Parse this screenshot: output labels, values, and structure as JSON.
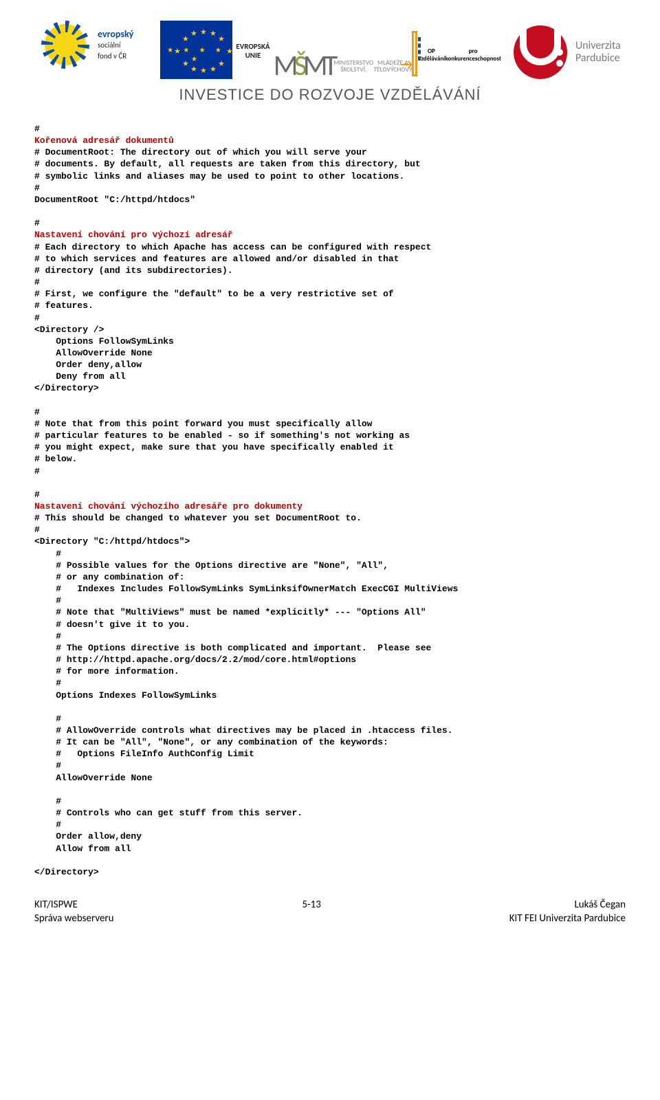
{
  "logos": {
    "esf": {
      "title": "evropský",
      "sub1": "sociální",
      "sub2": "fond v ČR"
    },
    "eu": {
      "caption": "EVROPSKÁ UNIE"
    },
    "msmt": {
      "line1": "MINISTERSTVO ŠKOLSTVÍ,",
      "line2": "MLÁDEŽE A TĚLOVÝCHOVY"
    },
    "op": {
      "line1": "OP Vzdělávání",
      "line2": "pro konkurenceschopnost"
    },
    "uni": {
      "line1": "Univerzita",
      "line2": "Pardubice"
    }
  },
  "banner": "INVESTICE DO ROZVOJE VZDĚLÁVÁNÍ",
  "code": {
    "s1_red": "Kořenová adresář dokumentů",
    "s1_body": "# DocumentRoot: The directory out of which you will serve your\n# documents. By default, all requests are taken from this directory, but\n# symbolic links and aliases may be used to point to other locations.\n#\nDocumentRoot \"C:/httpd/htdocs\"",
    "s2_red": "Nastavení chování pro výchozí adresář",
    "s2_body": "# Each directory to which Apache has access can be configured with respect\n# to which services and features are allowed and/or disabled in that\n# directory (and its subdirectories).\n#\n# First, we configure the \"default\" to be a very restrictive set of\n# features.\n#\n<Directory />\n    Options FollowSymLinks\n    AllowOverride None\n    Order deny,allow\n    Deny from all\n</Directory>\n\n#\n# Note that from this point forward you must specifically allow\n# particular features to be enabled - so if something's not working as\n# you might expect, make sure that you have specifically enabled it\n# below.\n#",
    "s3_red": "Nastavení chování výchozího adresáře pro dokumenty",
    "s3_body": "# This should be changed to whatever you set DocumentRoot to.\n#\n<Directory \"C:/httpd/htdocs\">\n    #\n    # Possible values for the Options directive are \"None\", \"All\",\n    # or any combination of:\n    #   Indexes Includes FollowSymLinks SymLinksifOwnerMatch ExecCGI MultiViews\n    #\n    # Note that \"MultiViews\" must be named *explicitly* --- \"Options All\"\n    # doesn't give it to you.\n    #\n    # The Options directive is both complicated and important.  Please see\n    # http://httpd.apache.org/docs/2.2/mod/core.html#options\n    # for more information.\n    #\n    Options Indexes FollowSymLinks\n\n    #\n    # AllowOverride controls what directives may be placed in .htaccess files.\n    # It can be \"All\", \"None\", or any combination of the keywords:\n    #   Options FileInfo AuthConfig Limit\n    #\n    AllowOverride None\n\n    #\n    # Controls who can get stuff from this server.\n    #\n    Order allow,deny\n    Allow from all\n\n</Directory>"
  },
  "footer": {
    "left1": "KIT/ISPWE",
    "left2": "Správa webserveru",
    "center": "5-13",
    "right1": "Lukáš Čegan",
    "right2": "KIT FEI Univerzita Pardubice"
  }
}
